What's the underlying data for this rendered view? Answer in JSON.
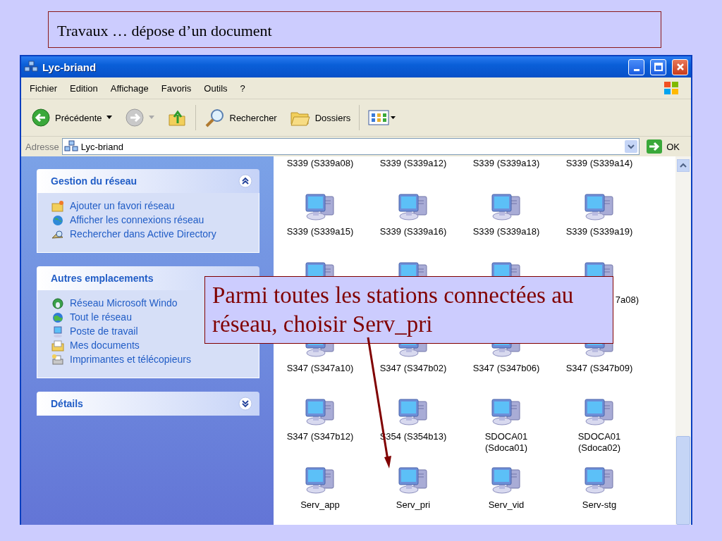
{
  "slide_title": "Travaux … dépose d’un document",
  "window": {
    "title": "Lyc-briand"
  },
  "menu": [
    "Fichier",
    "Edition",
    "Affichage",
    "Favoris",
    "Outils",
    "?"
  ],
  "toolbar": [
    {
      "kind": "back",
      "label": "Précédente",
      "disabled": false
    },
    {
      "kind": "forward",
      "disabled": true
    },
    {
      "kind": "up"
    },
    {
      "kind": "search",
      "label": "Rechercher"
    },
    {
      "kind": "folders",
      "label": "Dossiers"
    },
    {
      "kind": "views"
    }
  ],
  "address": {
    "label": "Adresse",
    "value": "Lyc-briand",
    "go": "OK"
  },
  "tasks": [
    {
      "title": "Gestion du réseau",
      "expanded": true,
      "items": [
        {
          "kind": "add-favorite",
          "label": "Ajouter un favori réseau"
        },
        {
          "kind": "connections",
          "label": "Afficher les connexions réseau"
        },
        {
          "kind": "directory",
          "label": "Rechercher dans Active Directory"
        }
      ]
    },
    {
      "title": "Autres emplacements",
      "items": [
        {
          "kind": "network",
          "label": "Réseau Microsoft Windo"
        },
        {
          "kind": "globe",
          "label": "Tout le réseau"
        },
        {
          "kind": "computer",
          "label": "Poste de travail"
        },
        {
          "kind": "documents",
          "label": "Mes documents"
        },
        {
          "kind": "printers",
          "label": "Imprimantes et télécopieurs"
        }
      ]
    },
    {
      "title": "Détails",
      "expanded": false
    }
  ],
  "items": [
    {
      "kind": "cut-top",
      "label": "S339 (S339a08)"
    },
    {
      "kind": "cut-top",
      "label": "S339 (S339a12)"
    },
    {
      "kind": "cut-top",
      "label": "S339 (S339a13)"
    },
    {
      "kind": "cut-top",
      "label": "S339 (S339a14)"
    },
    {
      "kind": "full",
      "label": "S339 (S339a15)"
    },
    {
      "kind": "full",
      "label": "S339 (S339a16)"
    },
    {
      "kind": "full",
      "label": "S339 (S339a18)"
    },
    {
      "kind": "full",
      "label": "S339 (S339a19)"
    },
    {
      "kind": "covered"
    },
    {
      "kind": "covered"
    },
    {
      "kind": "covered"
    },
    {
      "kind": "covered",
      "label": "7a08)"
    },
    {
      "kind": "full",
      "label": "S347 (S347a10)"
    },
    {
      "kind": "full",
      "label": "S347 (S347b02)"
    },
    {
      "kind": "full",
      "label": "S347 (S347b06)"
    },
    {
      "kind": "full",
      "label": "S347 (S347b09)"
    },
    {
      "kind": "full",
      "label": "S347 (S347b12)"
    },
    {
      "kind": "full",
      "label": "S354 (S354b13)"
    },
    {
      "kind": "full",
      "label": "SDOCA01 (Sdoca01)"
    },
    {
      "kind": "full",
      "label": "SDOCA01 (Sdoca02)"
    },
    {
      "kind": "full",
      "label": "Serv_app"
    },
    {
      "kind": "full",
      "label": "Serv_pri"
    },
    {
      "kind": "full",
      "label": "Serv_vid"
    },
    {
      "kind": "full",
      "label": "Serv-stg"
    }
  ],
  "callout": "Parmi toutes les stations connectées au réseau, choisir Serv_pri"
}
